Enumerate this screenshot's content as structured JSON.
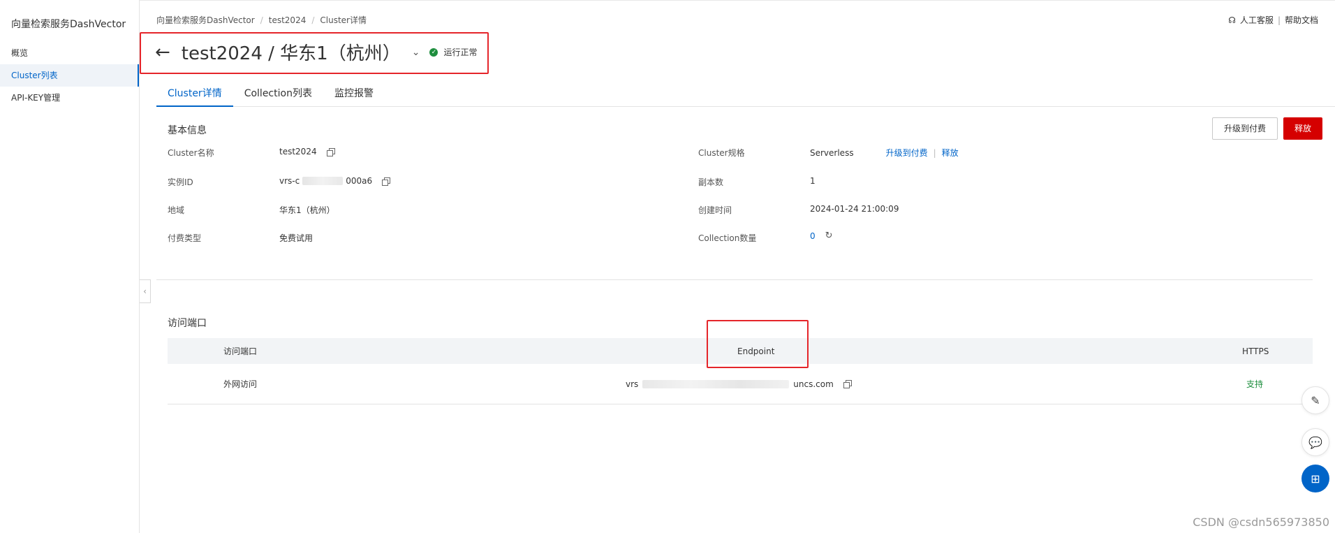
{
  "sidebar": {
    "product_name": "向量检索服务DashVector",
    "items": [
      {
        "label": "概览",
        "active": false
      },
      {
        "label": "Cluster列表",
        "active": true
      },
      {
        "label": "API-KEY管理",
        "active": false
      }
    ]
  },
  "breadcrumb": [
    "向量检索服务DashVector",
    "test2024",
    "Cluster详情"
  ],
  "top_links": {
    "support": "人工客服",
    "divider": "|",
    "docs": "帮助文档"
  },
  "header": {
    "title": "test2024 / 华东1（杭州）",
    "status": "运行正常"
  },
  "tabs": [
    {
      "label": "Cluster详情",
      "active": true
    },
    {
      "label": "Collection列表",
      "active": false
    },
    {
      "label": "监控报警",
      "active": false
    }
  ],
  "basic_info": {
    "title": "基本信息",
    "cluster_name_label": "Cluster名称",
    "cluster_name": "test2024",
    "instance_id_label": "实例ID",
    "instance_id_prefix": "vrs-c",
    "instance_id_suffix": "000a6",
    "region_label": "地域",
    "region": "华东1（杭州）",
    "billing_label": "付费类型",
    "billing": "免费试用",
    "spec_label": "Cluster规格",
    "spec": "Serverless",
    "upgrade_link": "升级到付费",
    "release_link": "释放",
    "link_sep": "|",
    "replica_label": "副本数",
    "replica": "1",
    "created_label": "创建时间",
    "created": "2024-01-24 21:00:09",
    "collection_count_label": "Collection数量",
    "collection_count": "0"
  },
  "actions": {
    "upgrade_button": "升级到付费",
    "release_button": "释放"
  },
  "access": {
    "title": "访问端口",
    "columns": [
      "访问端口",
      "Endpoint",
      "HTTPS"
    ],
    "rows": [
      {
        "port": "外网访问",
        "endpoint_prefix": "vrs",
        "endpoint_suffix": "uncs.com",
        "https": "支持"
      }
    ]
  },
  "watermark": "CSDN @csdn565973850",
  "colors": {
    "primary": "#0064c8",
    "danger": "#d50000",
    "success": "#1e8e3e",
    "highlight_box": "#e5252a"
  }
}
